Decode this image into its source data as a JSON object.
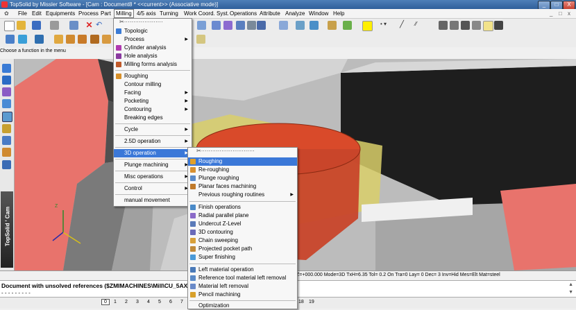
{
  "window": {
    "title": "TopSolid by Missler Software - [Cam : Document8 *  <<current>> (Associative mode)]",
    "controls": [
      "_",
      "□",
      "X"
    ],
    "mdi_controls": [
      "_",
      "□",
      "x"
    ]
  },
  "menubar": {
    "items": [
      "File",
      "Edit",
      "Equipments",
      "Process",
      "Part",
      "Milling",
      "4/5 axis",
      "Turning",
      "Work Coord. Syst.",
      "Operations",
      "Attribute",
      "Analyze",
      "Window",
      "Help"
    ],
    "active": "Milling"
  },
  "hint": "Choose a function in the menu",
  "side_label": "TopSolid ' Cam",
  "milling_menu": {
    "tearoff": "✂·····················",
    "items": [
      {
        "label": "Topologic",
        "submenu": false
      },
      {
        "label": "Process",
        "submenu": true
      },
      {
        "label": "Cylinder analysis",
        "submenu": false
      },
      {
        "label": "Hole analysis",
        "submenu": false
      },
      {
        "label": "Milling forms analysis",
        "submenu": false
      },
      {
        "label": "Roughing",
        "submenu": false
      },
      {
        "label": "Contour milling",
        "submenu": false
      },
      {
        "label": "Facing",
        "submenu": true
      },
      {
        "label": "Pocketing",
        "submenu": true
      },
      {
        "label": "Contouring",
        "submenu": true
      },
      {
        "label": "Breaking edges",
        "submenu": false
      },
      {
        "label": "Cycle",
        "submenu": true
      },
      {
        "label": "2.5D operation",
        "submenu": true
      },
      {
        "label": "3D operation",
        "submenu": true
      },
      {
        "label": "Plunge machining",
        "submenu": true
      },
      {
        "label": "Misc operations",
        "submenu": true
      },
      {
        "label": "Control",
        "submenu": true
      },
      {
        "label": "manual movement",
        "submenu": false
      }
    ]
  },
  "submenu_3d": {
    "tearoff": "✂·····························",
    "items": [
      {
        "label": "Roughing",
        "submenu": false
      },
      {
        "label": "Re-roughing",
        "submenu": false
      },
      {
        "label": "Plunge roughing",
        "submenu": false
      },
      {
        "label": "Planar faces machining",
        "submenu": false
      },
      {
        "label": "Previous roughing routines",
        "submenu": true
      },
      {
        "label": "Finish operations",
        "submenu": false
      },
      {
        "label": "Radial parallel plane",
        "submenu": false
      },
      {
        "label": "Undercut Z-Level",
        "submenu": false
      },
      {
        "label": "3D contouring",
        "submenu": false
      },
      {
        "label": "Chain sweeping",
        "submenu": false
      },
      {
        "label": "Projected pocket path",
        "submenu": false
      },
      {
        "label": "Super finishing",
        "submenu": false
      },
      {
        "label": "Left material operation",
        "submenu": false
      },
      {
        "label": "Reference tool material left removal",
        "submenu": false
      },
      {
        "label": "Material left removal",
        "submenu": false
      },
      {
        "label": "Pencil machining",
        "submenu": false
      },
      {
        "label": "Optimization",
        "submenu": false
      }
    ]
  },
  "statusbar": {
    "text": "Z=+000.000  Mode=3D  TxH=6.35  Tol= 0.2   On  Tra=0   Lay= 0   Dec= 3   Inv=Hid  Mes=Elt  Mat=steel"
  },
  "messages": {
    "line1": "Document with unsolved references ($ZMIMACHINES\\Mill\\CU_5AXES",
    "line2": "- - - - - - - - -"
  },
  "bottom_tabs": {
    "left": [
      "0",
      "1",
      "2",
      "3",
      "4",
      "5",
      "6",
      "7"
    ],
    "right": [
      "18",
      "19"
    ]
  },
  "colors": {
    "menu_highlight": "#3b78d8",
    "part_red": "#e8706a",
    "dark_block": "#222222"
  }
}
